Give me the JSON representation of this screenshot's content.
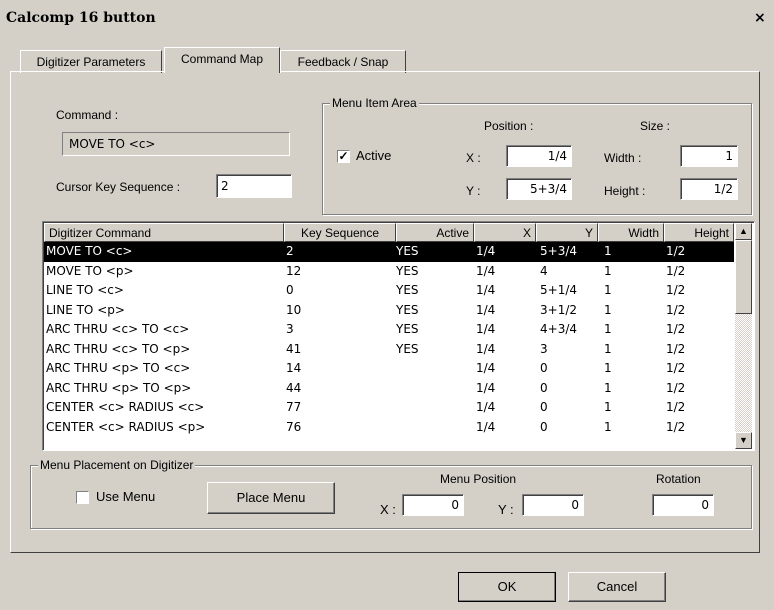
{
  "window": {
    "title": "Calcomp 16 button",
    "close": "×"
  },
  "tabs": [
    {
      "label": "Digitizer Parameters"
    },
    {
      "label": "Command Map"
    },
    {
      "label": "Feedback / Snap"
    }
  ],
  "command": {
    "label": "Command :",
    "value": "MOVE TO <c>"
  },
  "cursor_key": {
    "label": "Cursor Key Sequence :",
    "value": "2"
  },
  "menu_item_area": {
    "title": "Menu Item Area",
    "active_label": "Active",
    "active_checked": true,
    "position_label": "Position :",
    "size_label": "Size :",
    "x_label": "X :",
    "y_label": "Y :",
    "x_value": "1/4",
    "y_value": "5+3/4",
    "width_label": "Width :",
    "height_label": "Height :",
    "width_value": "1",
    "height_value": "1/2"
  },
  "table": {
    "columns": [
      "Digitizer Command",
      "Key Sequence",
      "Active",
      "X",
      "Y",
      "Width",
      "Height"
    ],
    "rows": [
      [
        "MOVE TO <c>",
        "2",
        "YES",
        "1/4",
        "5+3/4",
        "1",
        "1/2"
      ],
      [
        "MOVE TO <p>",
        "12",
        "YES",
        "1/4",
        "4",
        "1",
        "1/2"
      ],
      [
        "LINE TO <c>",
        "0",
        "YES",
        "1/4",
        "5+1/4",
        "1",
        "1/2"
      ],
      [
        "LINE TO <p>",
        "10",
        "YES",
        "1/4",
        "3+1/2",
        "1",
        "1/2"
      ],
      [
        "ARC THRU <c> TO <c>",
        "3",
        "YES",
        "1/4",
        "4+3/4",
        "1",
        "1/2"
      ],
      [
        "ARC THRU <c> TO <p>",
        "41",
        "YES",
        "1/4",
        "3",
        "1",
        "1/2"
      ],
      [
        "ARC THRU <p> TO <c>",
        "14",
        "",
        "1/4",
        "0",
        "1",
        "1/2"
      ],
      [
        "ARC THRU <p> TO <p>",
        "44",
        "",
        "1/4",
        "0",
        "1",
        "1/2"
      ],
      [
        "CENTER <c> RADIUS <c>",
        "77",
        "",
        "1/4",
        "0",
        "1",
        "1/2"
      ],
      [
        "CENTER <c> RADIUS <p>",
        "76",
        "",
        "1/4",
        "0",
        "1",
        "1/2"
      ]
    ],
    "selected_row": 0
  },
  "menu_placement": {
    "title": "Menu Placement on Digitizer",
    "use_menu_label": "Use Menu",
    "use_menu_checked": false,
    "place_menu_label": "Place Menu",
    "menu_position_label": "Menu Position",
    "x_label": "X :",
    "y_label": "Y :",
    "x_value": "0",
    "y_value": "0",
    "rotation_label": "Rotation",
    "rotation_value": "0"
  },
  "buttons": {
    "ok": "OK",
    "cancel": "Cancel"
  }
}
